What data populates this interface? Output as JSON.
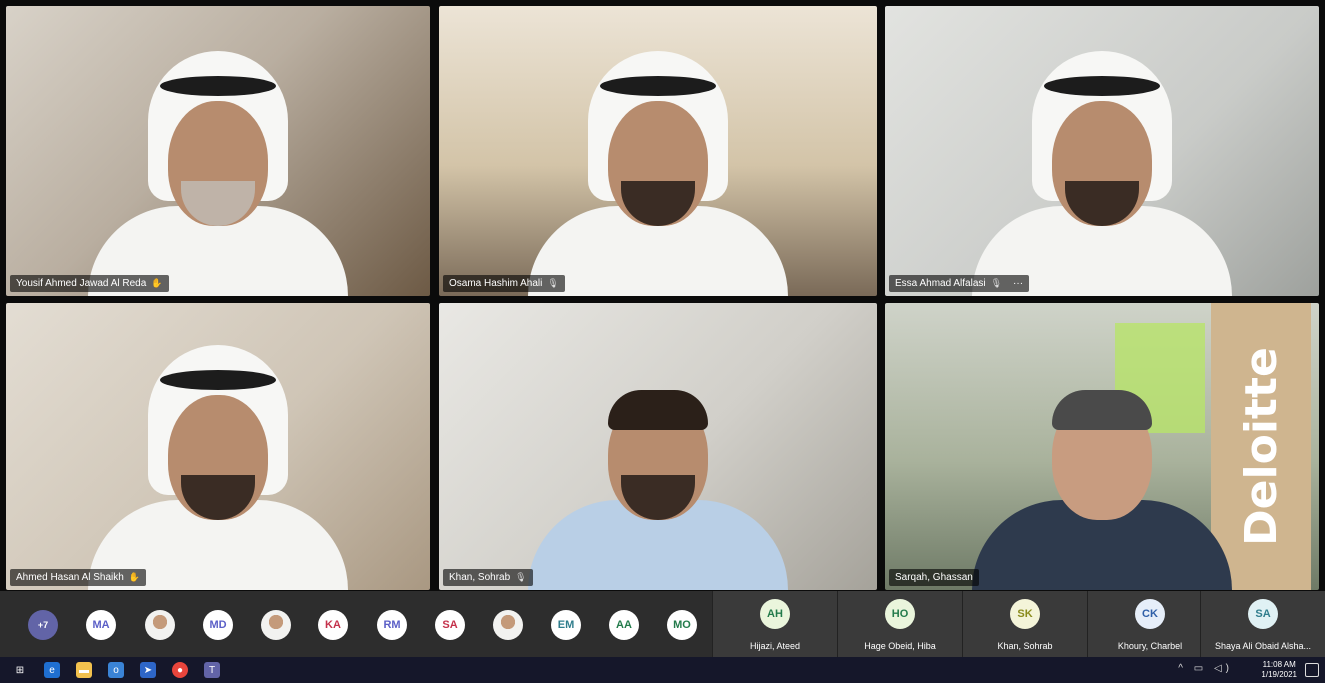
{
  "participants": [
    {
      "name": "Yousif Ahmed Jawad Al Reda",
      "status_icon": "raised-hand-icon"
    },
    {
      "name": "Osama Hashim Ahali",
      "status_icon": "mic-icon"
    },
    {
      "name": "Essa Ahmad Alfalasi",
      "status_icon": "mic-icon",
      "more": "···"
    },
    {
      "name": "Ahmed Hasan Al Shaikh",
      "status_icon": "raised-hand-icon"
    },
    {
      "name": "Khan, Sohrab",
      "status_icon": "mic-icon"
    },
    {
      "name": "Sarqah, Ghassan",
      "status_icon": "none"
    }
  ],
  "tile_backdrop_text": "Deloitte",
  "overflow_count": "+7",
  "avatars": [
    "MA",
    "MD",
    "KA",
    "RM",
    "SA",
    "EM",
    "AA",
    "MO"
  ],
  "mini_tiles": [
    {
      "initials": "AH",
      "name": "Hijazi, Ateed"
    },
    {
      "initials": "HO",
      "name": "Hage Obeid, Hiba"
    },
    {
      "initials": "SK",
      "name": "Khan, Sohrab"
    },
    {
      "initials": "CK",
      "name": "Khoury, Charbel"
    },
    {
      "initials": "SA",
      "name": "Shaya Ali Obaid Alsha..."
    }
  ],
  "taskbar": {
    "time": "11:08 AM",
    "date": "1/19/2021"
  },
  "colors": {
    "teams_accent": "#6264a7",
    "taskbar_bg": "#15172a"
  }
}
